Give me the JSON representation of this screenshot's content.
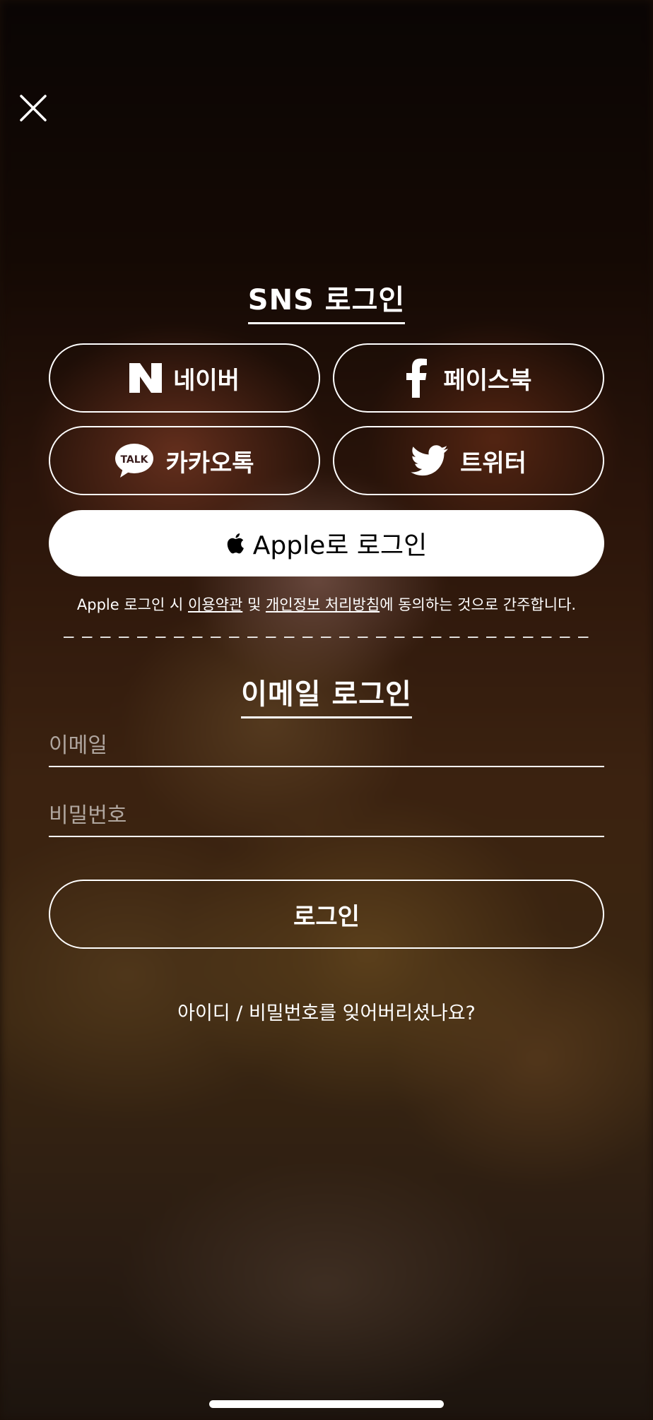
{
  "sns_section": {
    "title": "SNS 로그인",
    "naver_label": "네이버",
    "facebook_label": "페이스북",
    "kakao_label": "카카오톡",
    "kakao_badge": "TALK",
    "twitter_label": "트위터",
    "apple_label": "Apple로 로그인"
  },
  "terms": {
    "prefix": "Apple 로그인 시 ",
    "terms_link": "이용약관",
    "and": " 및 ",
    "privacy_link": "개인정보 처리방침",
    "suffix": "에 동의하는 것으로 간주합니다."
  },
  "email_section": {
    "title": "이메일 로그인",
    "email_placeholder": "이메일",
    "password_placeholder": "비밀번호",
    "login_label": "로그인",
    "forgot_label": "아이디 / 비밀번호를 잊어버리셨나요?"
  },
  "icons": {
    "close": "close-icon",
    "naver": "naver-icon",
    "facebook": "facebook-icon",
    "kakao": "kakaotalk-icon",
    "twitter": "twitter-icon",
    "apple": "apple-icon"
  },
  "colors": {
    "apple_button_bg": "#ffffff",
    "text": "#ffffff"
  }
}
